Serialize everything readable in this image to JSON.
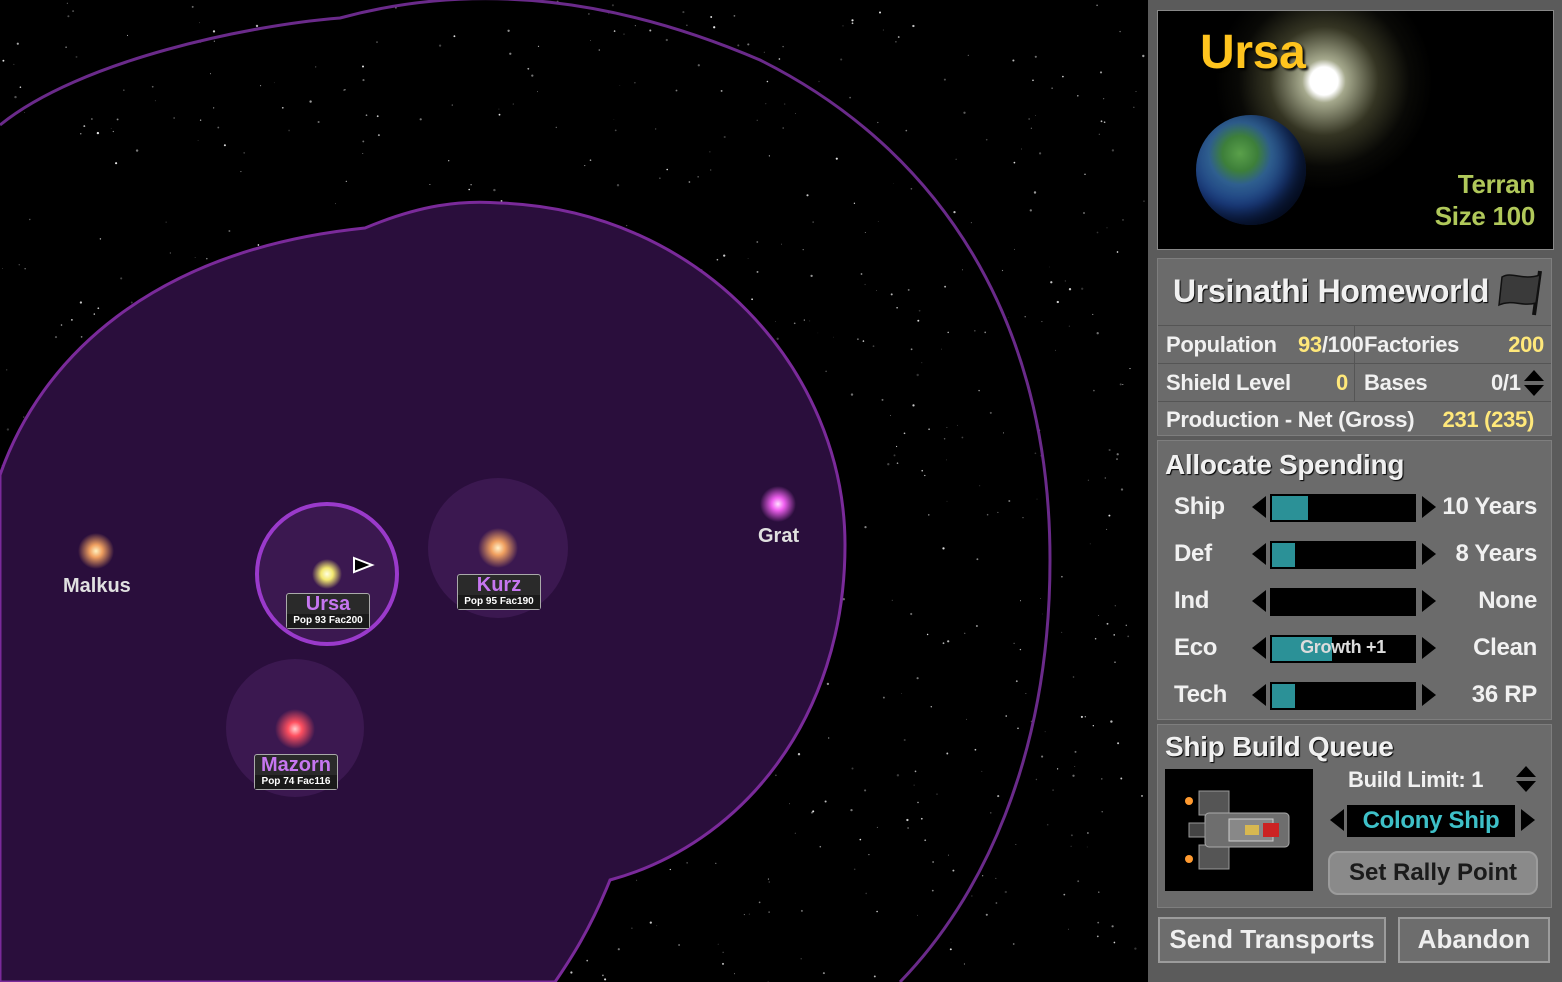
{
  "map": {
    "stars": [
      {
        "name": "Malkus",
        "color": "#f0a060"
      },
      {
        "name": "Grat",
        "color": "#f060f0"
      }
    ],
    "colonies": [
      {
        "name": "Ursa",
        "stats": "Pop 93  Fac200",
        "color": "#f3e870"
      },
      {
        "name": "Kurz",
        "stats": "Pop 95  Fac190",
        "color": "#f0a060"
      },
      {
        "name": "Mazorn",
        "stats": "Pop 74  Fac116",
        "color": "#ff5060"
      }
    ]
  },
  "planet": {
    "name": "Ursa",
    "type": "Terran",
    "size": "Size 100",
    "colony_name": "Ursinathi Homeworld",
    "population_label": "Population",
    "population_value": "93",
    "population_max": "/100",
    "factories_label": "Factories",
    "factories_value": "200",
    "shield_label": "Shield Level",
    "shield_value": "0",
    "bases_label": "Bases",
    "bases_value": "0/1",
    "production_label": "Production - Net (Gross)",
    "production_value": "231 (235)"
  },
  "spending": {
    "title": "Allocate Spending",
    "rows": [
      {
        "label": "Ship",
        "value": "10 Years",
        "fill": 0.25,
        "bar_text": ""
      },
      {
        "label": "Def",
        "value": "8 Years",
        "fill": 0.16,
        "bar_text": ""
      },
      {
        "label": "Ind",
        "value": "None",
        "fill": 0.0,
        "bar_text": ""
      },
      {
        "label": "Eco",
        "value": "Clean",
        "fill": 0.42,
        "bar_text": "Growth +1"
      },
      {
        "label": "Tech",
        "value": "36 RP",
        "fill": 0.16,
        "bar_text": ""
      }
    ]
  },
  "queue": {
    "title": "Ship Build Queue",
    "build_limit": "Build Limit:  1",
    "ship_design": "Colony Ship",
    "rally_label": "Set Rally Point"
  },
  "actions": {
    "transports_label": "Send Transports",
    "abandon_label": "Abandon"
  },
  "colors": {
    "empire": "#7a2a9a",
    "accent_yellow": "#ffe87a",
    "planet_name": "#ffc41e",
    "planet_type": "#b0c85a",
    "bar_fill": "#2b9197"
  }
}
